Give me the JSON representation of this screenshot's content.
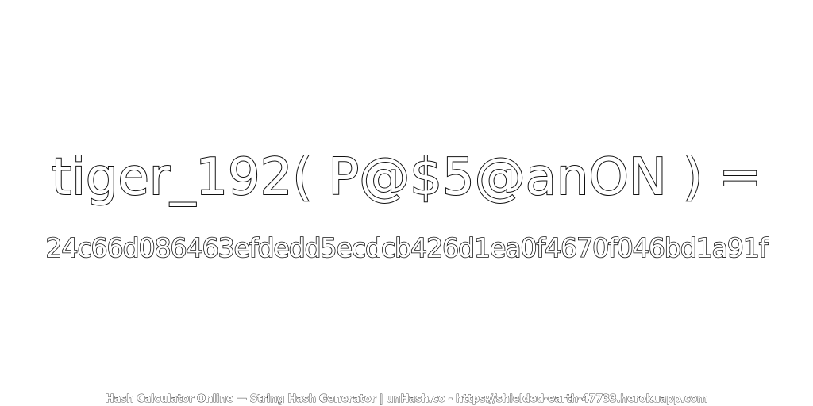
{
  "headline": "tiger_192( P@$5@anON ) =",
  "hash_value": "24c66d086463efdedd5ecdcb426d1ea0f4670f046bd1a91f",
  "footer": "Hash Calculator Online — String Hash Generator | unHash.co - https://shielded-earth-47733.herokuapp.com",
  "colors": {
    "background": "#ffffff",
    "text_fill": "#ffffff",
    "text_outline": "#111111"
  }
}
